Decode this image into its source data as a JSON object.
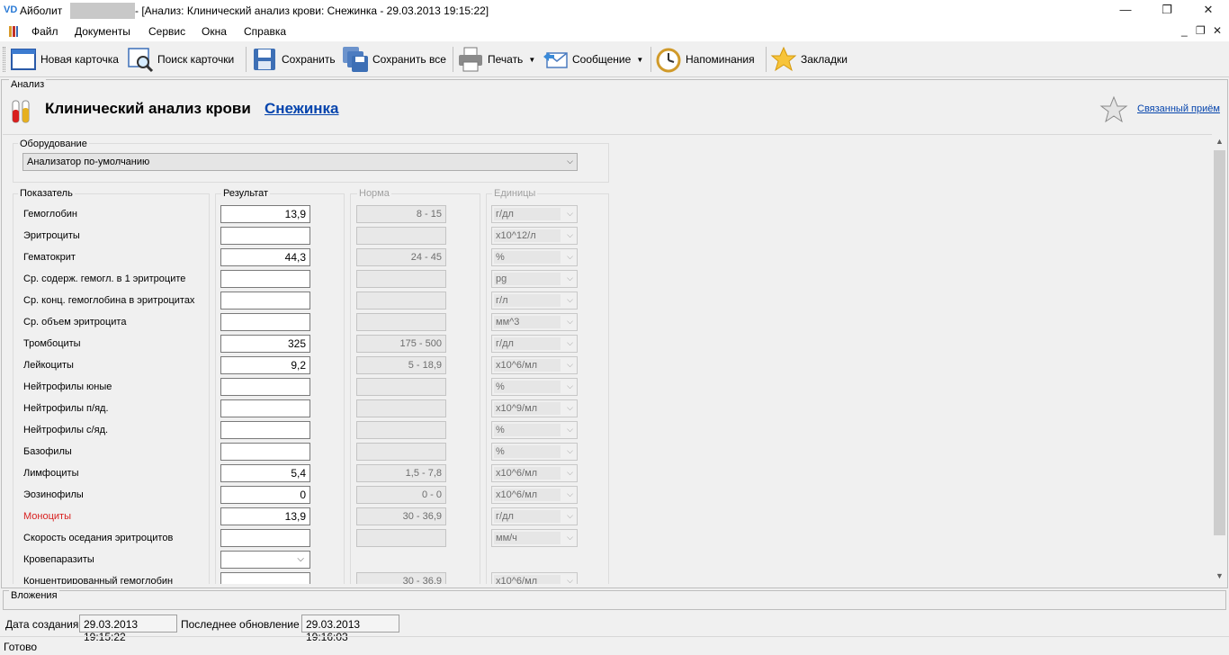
{
  "window": {
    "logo": "VD",
    "app_name": "Айболит",
    "title": "- [Анализ: Клинический анализ крови: Снежинка - 29.03.2013 19:15:22]",
    "minimize": "—",
    "maximize": "❐",
    "close": "✕"
  },
  "menu": {
    "items": [
      "Файл",
      "Документы",
      "Сервис",
      "Окна",
      "Справка"
    ],
    "mdi_min": "_",
    "mdi_restore": "❐",
    "mdi_close": "✕"
  },
  "toolbar": {
    "new_card": "Новая карточка",
    "search_card": "Поиск карточки",
    "save": "Сохранить",
    "save_all": "Сохранить все",
    "print": "Печать",
    "message": "Сообщение",
    "reminders": "Напоминания",
    "bookmarks": "Закладки",
    "dropdown_arrow": "▼"
  },
  "analysis": {
    "panel_label": "Анализ",
    "title": "Клинический анализ крови",
    "patient_link": "Снежинка",
    "related_link": "Связанный приём",
    "equipment_label": "Оборудование",
    "equipment_value": "Анализатор по-умолчанию",
    "col_indicator": "Показатель",
    "col_result": "Результат",
    "col_norm": "Норма",
    "col_units": "Единицы",
    "chevron": "⌵",
    "rows": [
      {
        "label": "Гемоглобин",
        "result": "13,9",
        "norm": "8 - 15",
        "unit": "г/дл"
      },
      {
        "label": "Эритроциты",
        "result": "",
        "norm": "",
        "unit": "x10^12/л"
      },
      {
        "label": "Гематокрит",
        "result": "44,3",
        "norm": "24 - 45",
        "unit": "%"
      },
      {
        "label": "Ср. содерж. гемогл. в 1 эритроците",
        "result": "",
        "norm": "",
        "unit": "pg"
      },
      {
        "label": "Ср. конц. гемоглобина в эритроцитах",
        "result": "",
        "norm": "",
        "unit": "г/л"
      },
      {
        "label": "Ср. объем эритроцита",
        "result": "",
        "norm": "",
        "unit": "мм^3"
      },
      {
        "label": "Тромбоциты",
        "result": "325",
        "norm": "175 - 500",
        "unit": "г/дл"
      },
      {
        "label": "Лейкоциты",
        "result": "9,2",
        "norm": "5 - 18,9",
        "unit": "x10^6/мл"
      },
      {
        "label": "Нейтрофилы юные",
        "result": "",
        "norm": "",
        "unit": "%"
      },
      {
        "label": "Нейтрофилы п/яд.",
        "result": "",
        "norm": "",
        "unit": "x10^9/мл"
      },
      {
        "label": "Нейтрофилы с/яд.",
        "result": "",
        "norm": "",
        "unit": "%"
      },
      {
        "label": "Базофилы",
        "result": "",
        "norm": "",
        "unit": "%"
      },
      {
        "label": "Лимфоциты",
        "result": "5,4",
        "norm": "1,5 - 7,8",
        "unit": "x10^6/мл"
      },
      {
        "label": "Эозинофилы",
        "result": "0",
        "norm": "0 - 0",
        "unit": "x10^6/мл"
      },
      {
        "label": "Моноциты",
        "result": "13,9",
        "norm": "30 - 36,9",
        "unit": "г/дл",
        "highlight": true
      },
      {
        "label": "Скорость оседания эритроцитов",
        "result": "",
        "norm": "",
        "unit": "мм/ч"
      },
      {
        "label": "Кровепаразиты",
        "result": "",
        "norm": null,
        "unit": null,
        "combo": true
      },
      {
        "label": "Концентрированный гемоглобин",
        "result": "",
        "norm": "30 - 36,9",
        "unit": "x10^6/мл"
      }
    ]
  },
  "attachments": {
    "label": "Вложения"
  },
  "status": {
    "created_label": "Дата создания",
    "created_value": "29.03.2013 19:15:22",
    "updated_label": "Последнее обновление",
    "updated_value": "29.03.2013 19:16:03",
    "ready": "Готово"
  },
  "colors": {
    "link": "#0645ad",
    "highlight_label": "#d8201f",
    "logo": "#2a7ad6"
  }
}
